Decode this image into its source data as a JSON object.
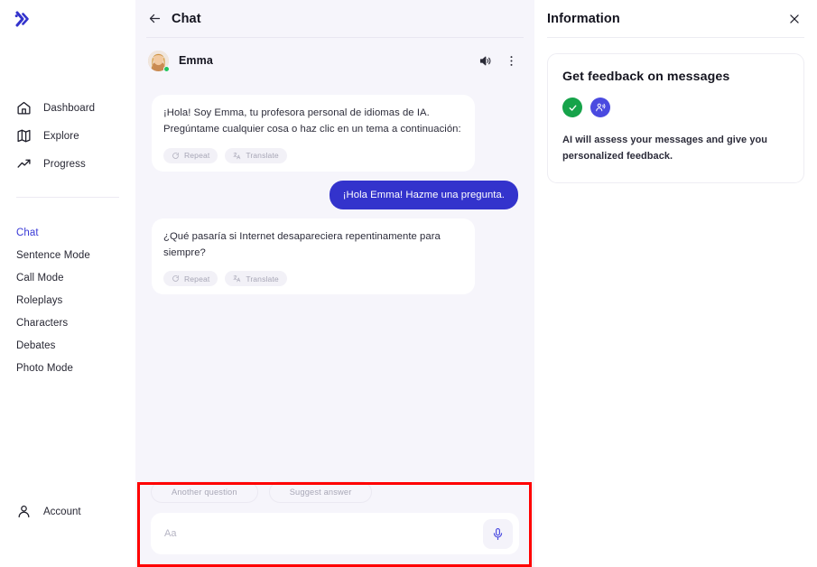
{
  "sidebar": {
    "logo_name": "soundwave-logo",
    "nav": [
      {
        "label": "Dashboard",
        "icon": "home-icon"
      },
      {
        "label": "Explore",
        "icon": "map-icon"
      },
      {
        "label": "Progress",
        "icon": "trending-up-icon"
      }
    ],
    "modes": [
      {
        "label": "Chat",
        "active": true
      },
      {
        "label": "Sentence Mode",
        "active": false
      },
      {
        "label": "Call Mode",
        "active": false
      },
      {
        "label": "Roleplays",
        "active": false
      },
      {
        "label": "Characters",
        "active": false
      },
      {
        "label": "Debates",
        "active": false
      },
      {
        "label": "Photo Mode",
        "active": false
      }
    ],
    "account": {
      "label": "Account",
      "icon": "person-icon"
    }
  },
  "chat": {
    "title": "Chat",
    "back_icon": "arrow-left-icon",
    "partner": {
      "name": "Emma",
      "status": "online",
      "speaker_icon": "speaker-icon",
      "menu_icon": "more-vertical-icon"
    },
    "messages": [
      {
        "from": "assistant",
        "text": "¡Hola! Soy Emma, tu profesora personal de idiomas de IA. Pregúntame cualquier cosa o haz clic en un tema a continuación:",
        "actions": [
          {
            "label": "Repeat",
            "icon": "repeat-icon"
          },
          {
            "label": "Translate",
            "icon": "translate-icon"
          }
        ]
      },
      {
        "from": "user",
        "text": "¡Hola Emma! Hazme una pregunta."
      },
      {
        "from": "assistant",
        "text": "¿Qué pasaría si Internet desapareciera repentinamente para siempre?",
        "actions": [
          {
            "label": "Repeat",
            "icon": "repeat-icon"
          },
          {
            "label": "Translate",
            "icon": "translate-icon"
          }
        ]
      }
    ],
    "composer": {
      "suggestions": [
        "Another question",
        "Suggest answer"
      ],
      "input_placeholder": "Aa",
      "input_value": "",
      "mic_icon": "microphone-icon",
      "highlight_color": "#ff0000"
    }
  },
  "info": {
    "title": "Information",
    "close_icon": "close-icon",
    "card": {
      "title": "Get feedback on messages",
      "badges": [
        {
          "icon": "check-icon",
          "color": "#16a34a"
        },
        {
          "icon": "person-speaking-icon",
          "color": "#4a4ae0"
        }
      ],
      "description": "AI will assess your messages and give you personalized feedback."
    }
  },
  "colors": {
    "accent": "#3333cc",
    "chat_bg": "#f6f5fb",
    "online": "#22c55e"
  }
}
